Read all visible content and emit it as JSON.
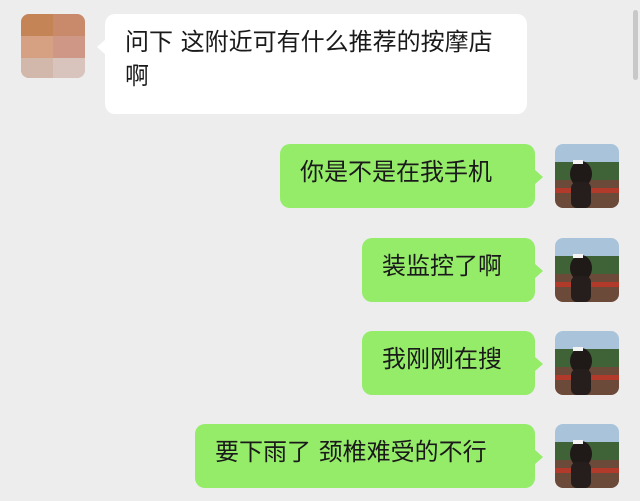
{
  "messages": [
    {
      "side": "in",
      "text": "问下 这附近可有什么推荐的按摩店啊"
    },
    {
      "side": "out",
      "text": "你是不是在我手机"
    },
    {
      "side": "out",
      "text": "装监控了啊"
    },
    {
      "side": "out",
      "text": "我刚刚在搜"
    },
    {
      "side": "out",
      "text": "要下雨了 颈椎难受的不行"
    }
  ],
  "avatars": {
    "incoming": "pixelated-avatar-icon",
    "outgoing": "girl-on-balcony-avatar-icon"
  },
  "colors": {
    "background": "#ededed",
    "incoming_bubble": "#ffffff",
    "outgoing_bubble": "#95ec69"
  }
}
